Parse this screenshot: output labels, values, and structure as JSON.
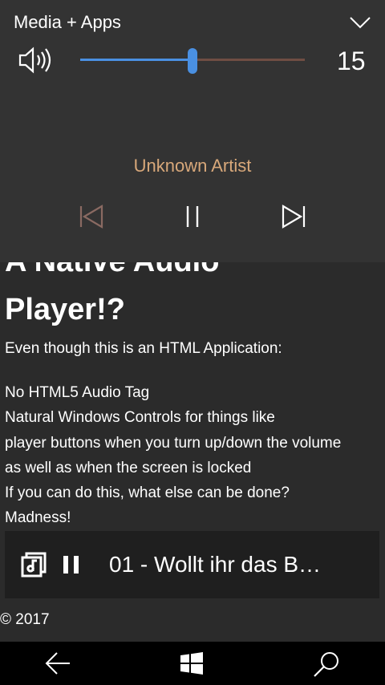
{
  "page": {
    "heading_line1": "A Native Audio",
    "heading_line2": "Player!?",
    "intro": "Even though this is an HTML Application:",
    "lines": [
      "No HTML5 Audio Tag",
      "Natural Windows Controls for things like",
      "player buttons when you turn up/down the volume",
      "as well as when the screen is locked",
      "If you can do this, what else can be done?",
      "Madness!"
    ],
    "copyright": "© 2017"
  },
  "now_playing": {
    "title": "01 - Wollt ihr das B…",
    "note_icon": "music-note-icon",
    "pause_icon": "pause-icon"
  },
  "volume_flyout": {
    "title": "Media + Apps",
    "volume": 15,
    "volume_level": 0.5,
    "artist": "Unknown Artist",
    "accent_color": "#4a90e2"
  },
  "navbar": {
    "back_icon": "back-arrow-icon",
    "windows_icon": "windows-logo-icon",
    "search_icon": "search-icon"
  }
}
